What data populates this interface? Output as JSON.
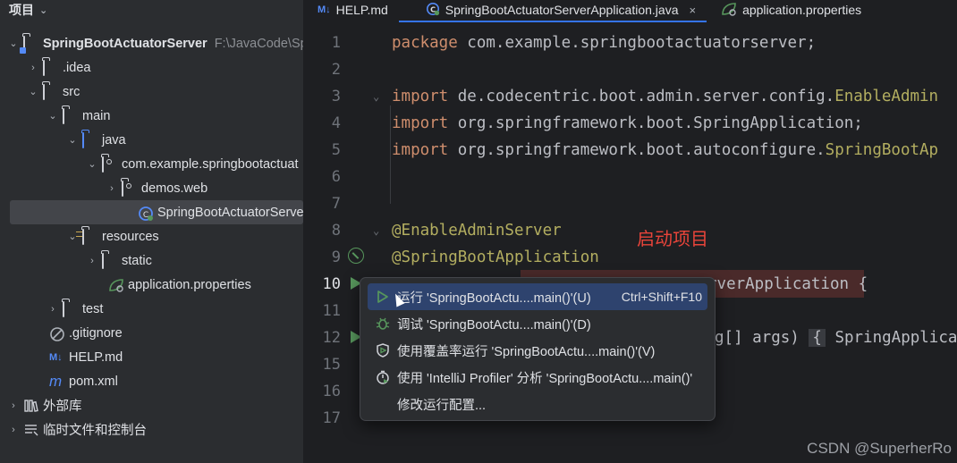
{
  "project": {
    "title": "项目",
    "tree": [
      {
        "label": "SpringBootActuatorServer",
        "path": "F:\\JavaCode\\Spr",
        "arrow": "⌄",
        "bold": true
      },
      {
        "label": ".idea",
        "arrow": "›"
      },
      {
        "label": "src",
        "arrow": "⌄"
      },
      {
        "label": "main",
        "arrow": "⌄"
      },
      {
        "label": "java",
        "arrow": "⌄"
      },
      {
        "label": "com.example.springbootactuat",
        "arrow": "⌄"
      },
      {
        "label": "demos.web",
        "arrow": "›"
      },
      {
        "label": "SpringBootActuatorServerA",
        "arrow": ""
      },
      {
        "label": "resources",
        "arrow": "⌄"
      },
      {
        "label": "static",
        "arrow": "›"
      },
      {
        "label": "application.properties",
        "arrow": ""
      },
      {
        "label": "test",
        "arrow": "›"
      },
      {
        "label": ".gitignore",
        "arrow": ""
      },
      {
        "label": "HELP.md",
        "arrow": ""
      },
      {
        "label": "pom.xml",
        "arrow": ""
      },
      {
        "label": "外部库",
        "arrow": "›"
      },
      {
        "label": "临时文件和控制台",
        "arrow": "›"
      }
    ]
  },
  "tabs": [
    {
      "label": "HELP.md",
      "icon": "M↓"
    },
    {
      "label": "SpringBootActuatorServerApplication.java",
      "close": "×"
    },
    {
      "label": "application.properties"
    }
  ],
  "editor": {
    "lines": [
      {
        "num": "1",
        "kw": "package",
        "rest": " com.example.springbootactuatorserver;"
      },
      {
        "num": "2"
      },
      {
        "num": "3",
        "kw": "import",
        "rest": " de.codecentric.boot.admin.server.config.",
        "cls": "EnableAdmin"
      },
      {
        "num": "4",
        "kw": "import",
        "rest": " org.springframework.boot.SpringApplication;"
      },
      {
        "num": "5",
        "kw": "import",
        "rest": " org.springframework.boot.autoconfigure.",
        "cls": "SpringBootAp"
      },
      {
        "num": "6"
      },
      {
        "num": "7"
      },
      {
        "num": "8",
        "ann": "@EnableAdminServer"
      },
      {
        "num": "9",
        "ann": "@SpringBootApplication"
      },
      {
        "num": "10",
        "tail": "rverApplication {"
      },
      {
        "num": "11"
      },
      {
        "num": "12",
        "tail": "g[] args) ",
        "box": "{",
        "tail2": " SpringApplica"
      },
      {
        "num": "15"
      },
      {
        "num": "16"
      },
      {
        "num": "17"
      }
    ]
  },
  "annotation": "启动项目",
  "popup": {
    "items": [
      {
        "label": "运行 'SpringBootActu....main()'(U)",
        "shortcut": "Ctrl+Shift+F10",
        "icon": "run-icon"
      },
      {
        "label": "调试 'SpringBootActu....main()'(D)",
        "icon": "debug-icon"
      },
      {
        "label": "使用覆盖率运行 'SpringBootActu....main()'(V)",
        "icon": "coverage-icon"
      },
      {
        "label": "使用 'IntelliJ Profiler' 分析  'SpringBootActu....main()'",
        "icon": "profiler-icon"
      },
      {
        "label": "修改运行配置...",
        "icon": ""
      }
    ]
  },
  "watermark": "CSDN @SuperherRo",
  "colors": {
    "keyword": "#cf8e6d",
    "annotation": "#b3ae60",
    "run_green": "#57965c",
    "selection": "#2e436e",
    "accent": "#3574f0"
  }
}
